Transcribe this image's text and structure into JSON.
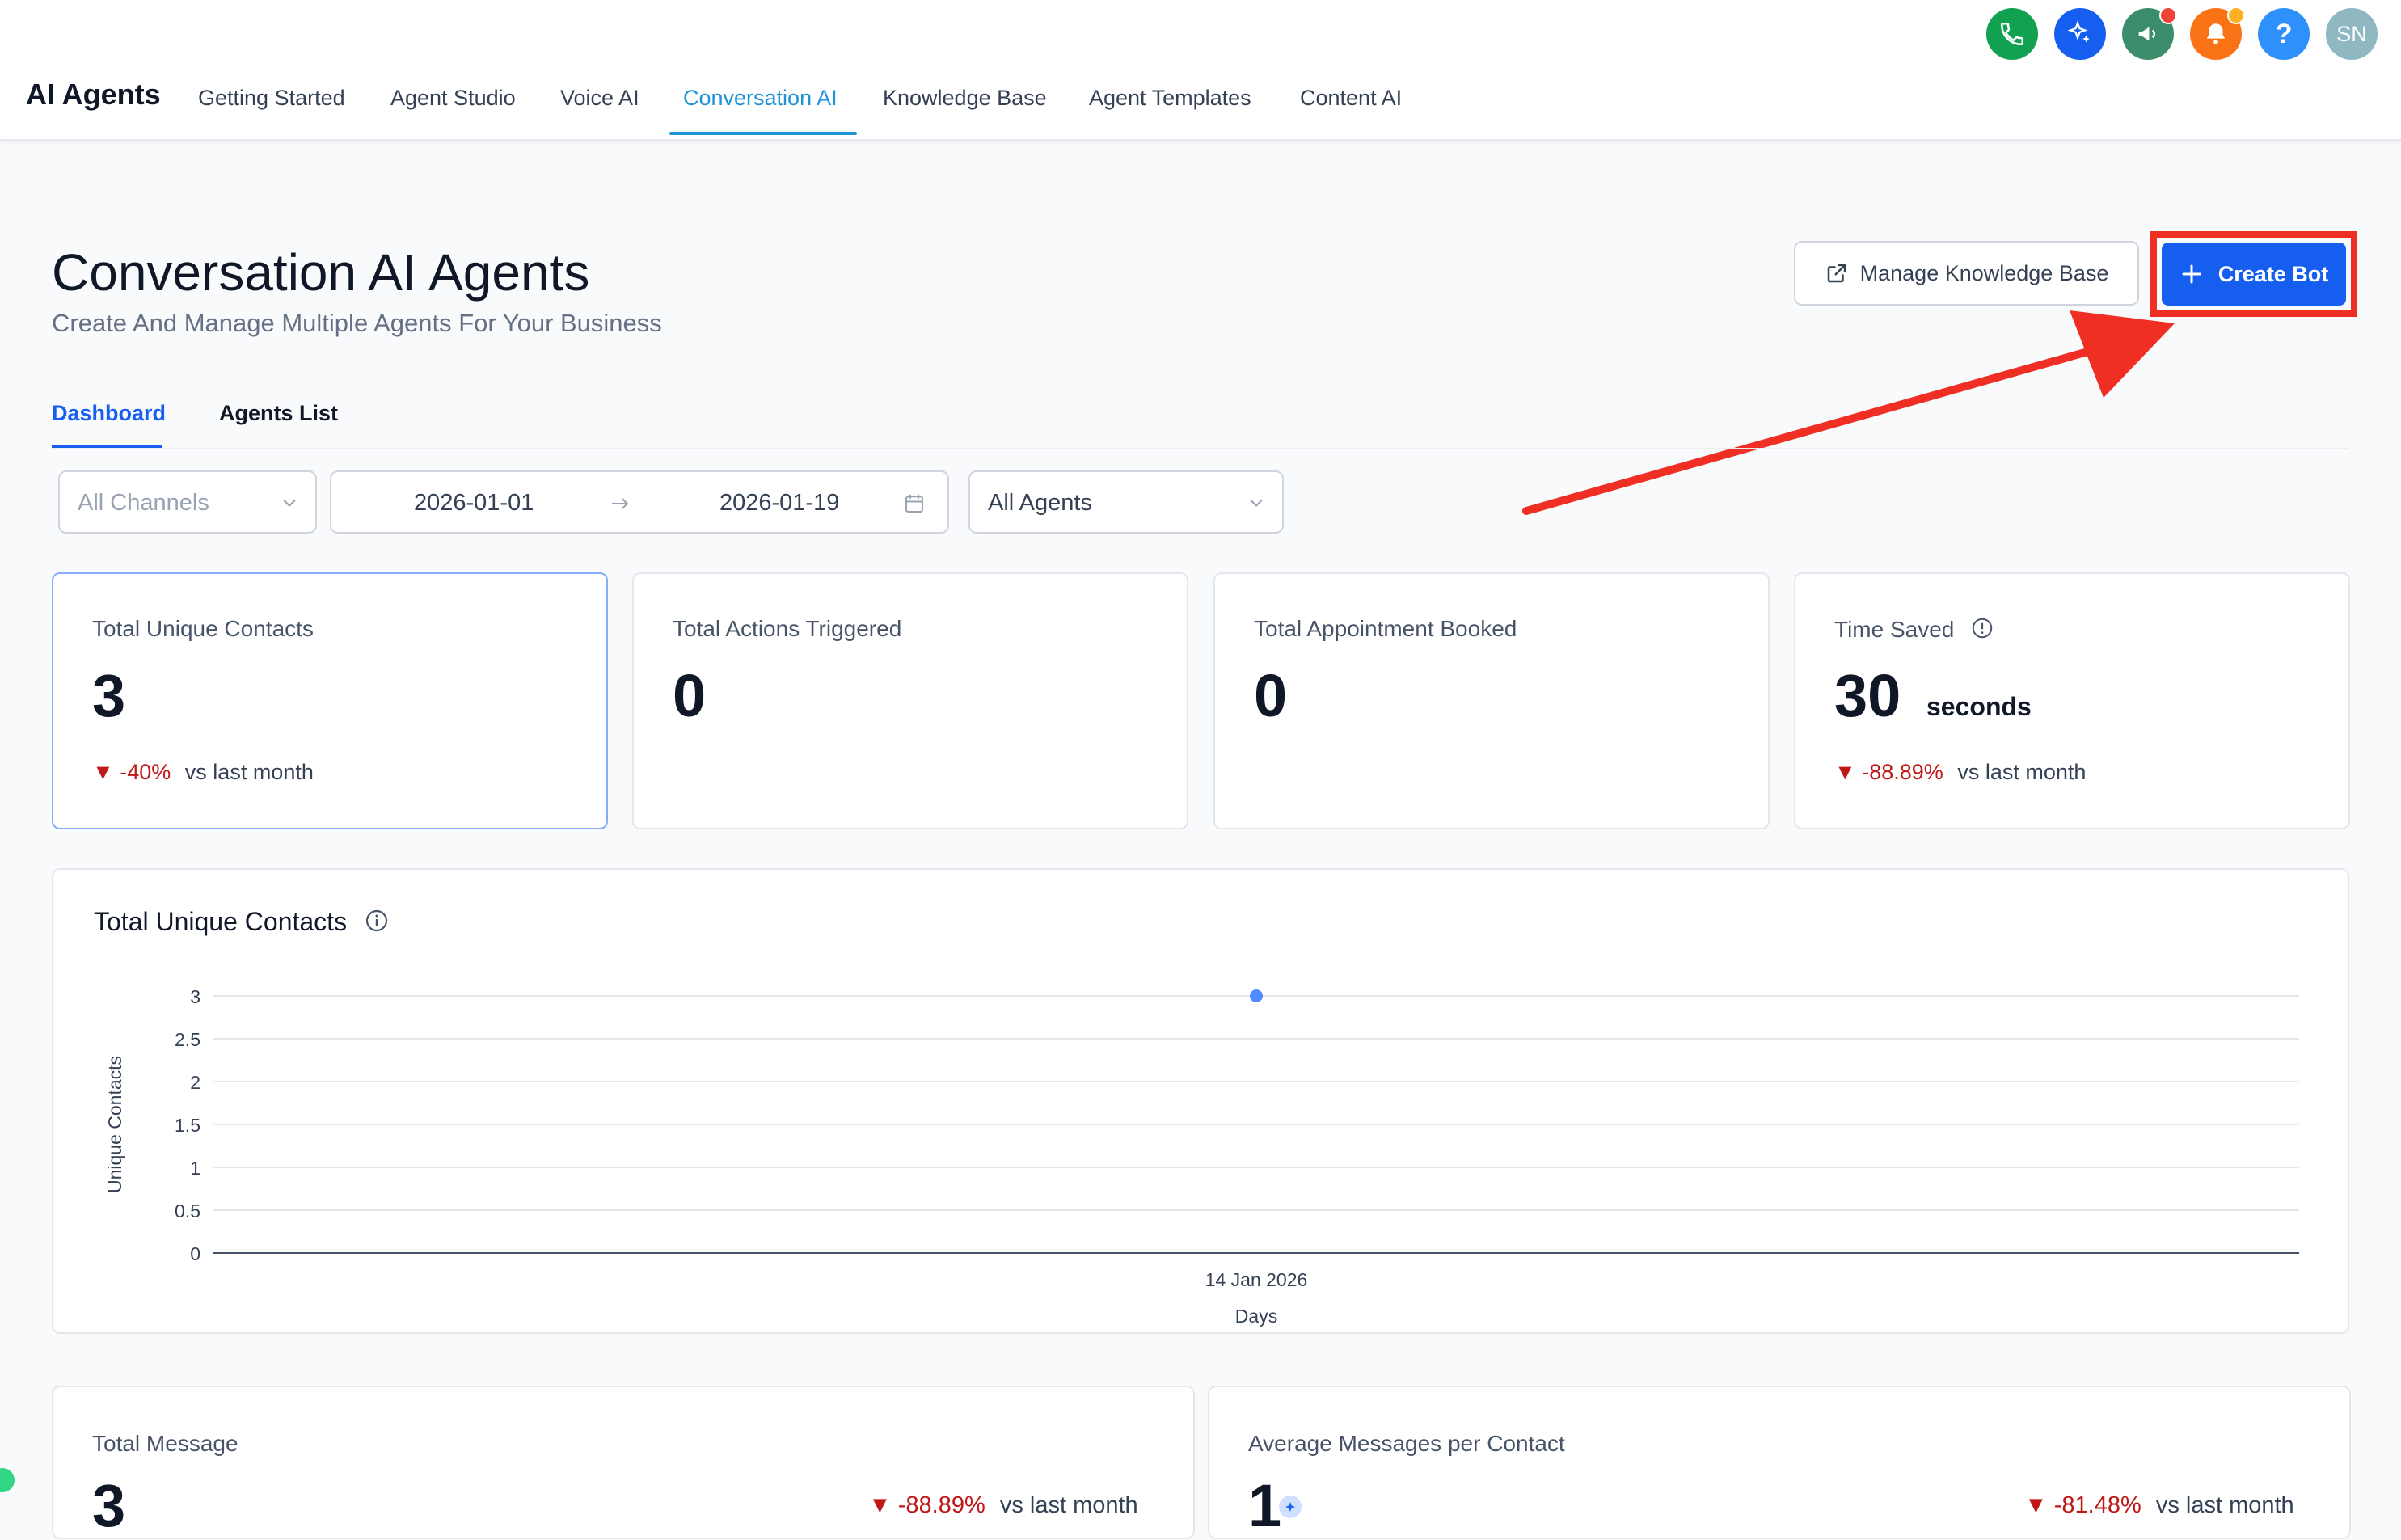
{
  "app": {
    "title": "AI Agents"
  },
  "nav": {
    "tabs": [
      {
        "label": "Getting Started"
      },
      {
        "label": "Agent Studio"
      },
      {
        "label": "Voice AI"
      },
      {
        "label": "Conversation AI"
      },
      {
        "label": "Knowledge Base"
      },
      {
        "label": "Agent Templates"
      },
      {
        "label": "Content AI"
      }
    ],
    "active_tab": "Conversation AI",
    "icons": [
      "phone-icon",
      "sparkle-icon",
      "megaphone-icon",
      "bell-icon",
      "help-icon"
    ],
    "avatar_initials": "SN",
    "help_glyph": "?"
  },
  "header": {
    "title": "Conversation AI Agents",
    "subtitle": "Create And Manage Multiple Agents For Your Business",
    "manage_kb_label": "Manage Knowledge Base",
    "create_bot_label": "Create Bot"
  },
  "subtabs": [
    {
      "label": "Dashboard"
    },
    {
      "label": "Agents List"
    }
  ],
  "filters": {
    "channel": "All Channels",
    "date_start": "2026-01-01",
    "date_end": "2026-01-19",
    "agent": "All Agents"
  },
  "metrics": [
    {
      "label": "Total Unique Contacts",
      "value": "3",
      "change": "-40%",
      "compare": "vs last month"
    },
    {
      "label": "Total Actions Triggered",
      "value": "0"
    },
    {
      "label": "Total Appointment Booked",
      "value": "0"
    },
    {
      "label": "Time Saved",
      "value": "30",
      "unit": "seconds",
      "change": "-88.89%",
      "compare": "vs last month"
    }
  ],
  "chart_title": "Total Unique Contacts",
  "chart_data": {
    "type": "line",
    "x": [
      "14 Jan 2026"
    ],
    "series": [
      {
        "values": [
          3
        ]
      }
    ],
    "xlabel": "Days",
    "ylabel": "Unique Contacts",
    "ylim": [
      0,
      3
    ],
    "yticks": [
      "0",
      "0.5",
      "1",
      "1.5",
      "2",
      "2.5",
      "3"
    ],
    "grid": true
  },
  "bottom_metrics": [
    {
      "label": "Total Message",
      "value": "3",
      "change": "-88.89%",
      "compare": "vs last month"
    },
    {
      "label": "Average Messages per Contact",
      "value": "1",
      "change": "-81.48%",
      "compare": "vs last month"
    }
  ],
  "colors": {
    "primary": "#155EEF",
    "nav_active": "#1F93D5",
    "highlight_annotation": "#EF2F24",
    "negative": "#C01717",
    "chart_point": "#528BFF"
  }
}
